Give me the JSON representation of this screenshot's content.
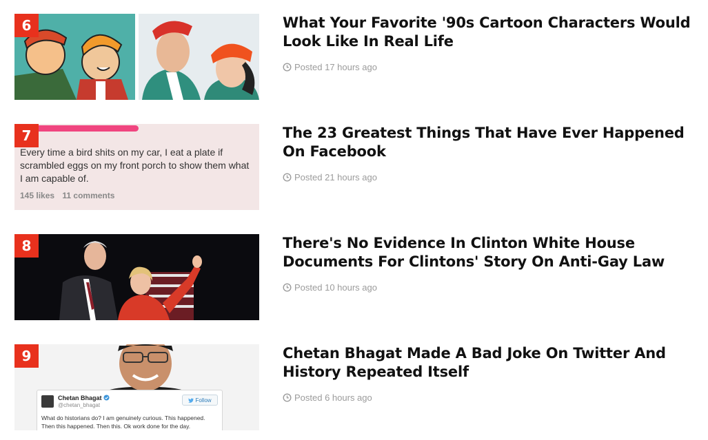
{
  "articles": [
    {
      "rank": "6",
      "title": "What Your Favorite '90s Cartoon Characters Would Look Like In Real Life",
      "posted": "Posted 17 hours ago"
    },
    {
      "rank": "7",
      "title": "The 23 Greatest Things That Have Ever Happened On Facebook",
      "posted": "Posted 21 hours ago",
      "thumb": {
        "post_text": "Every time a bird shits on my car, I eat a plate if scrambled eggs on my front porch to show them what I am capable of.",
        "likes": "145 likes",
        "comments": "11 comments"
      }
    },
    {
      "rank": "8",
      "title": "There's No Evidence In Clinton White House Documents For Clintons' Story On Anti-Gay Law",
      "posted": "Posted 10 hours ago"
    },
    {
      "rank": "9",
      "title": "Chetan Bhagat Made A Bad Joke On Twitter And History Repeated Itself",
      "posted": "Posted 6 hours ago",
      "thumb": {
        "tweet_name": "Chetan Bhagat",
        "tweet_handle": "@chetan_bhagat",
        "follow_label": "Follow",
        "tweet_text": "What do historians do? I am genuinely curious. This happened. Then this happened. Then this. Ok work done for the day."
      }
    }
  ],
  "colors": {
    "rank_badge": "#e8311d",
    "meta": "#9b9b9b",
    "redaction": "#f0457f"
  },
  "icons": {
    "meta": "clock-icon",
    "tweet_verified": "verified-icon",
    "tweet_follow": "twitter-bird-icon"
  }
}
